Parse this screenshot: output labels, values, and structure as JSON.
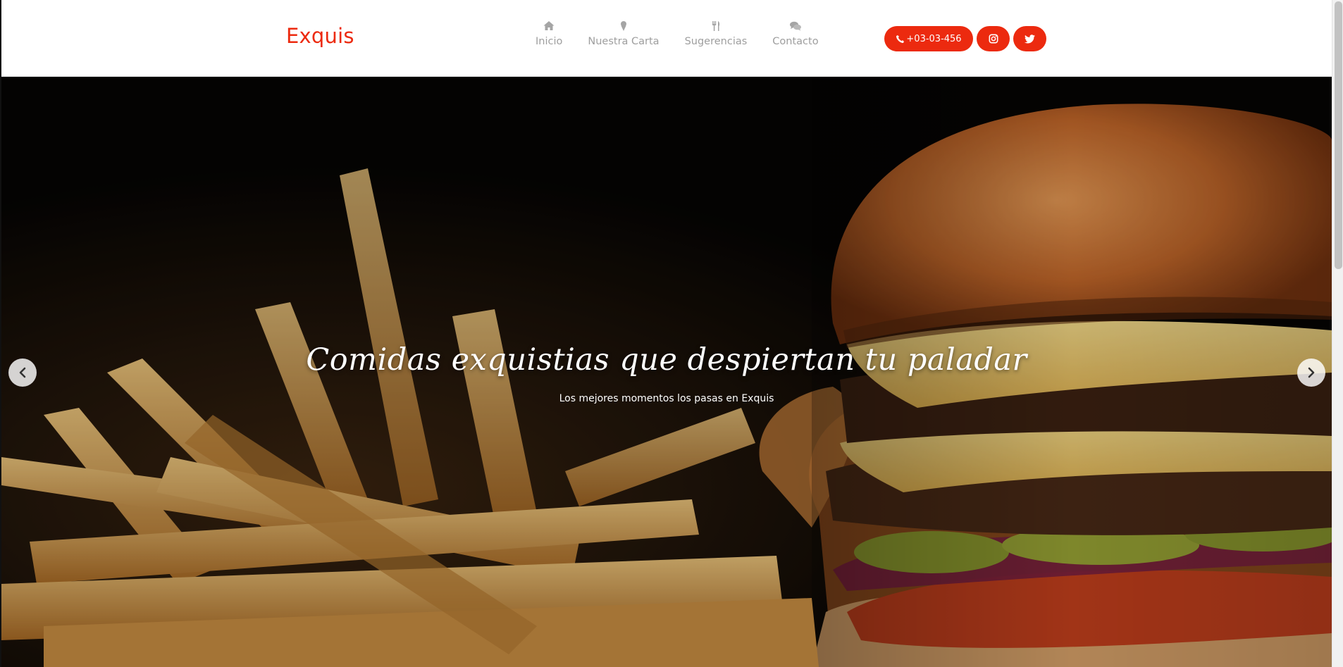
{
  "header": {
    "brand": "Exquis",
    "nav": [
      {
        "label": "Inicio",
        "icon": "home-icon"
      },
      {
        "label": "Nuestra Carta",
        "icon": "ice-cream-icon"
      },
      {
        "label": "Sugerencias",
        "icon": "cutlery-icon"
      },
      {
        "label": "Contacto",
        "icon": "comments-icon"
      }
    ],
    "phone_label": "+03-03-456",
    "social": [
      {
        "icon": "instagram-icon"
      },
      {
        "icon": "twitter-icon"
      }
    ]
  },
  "hero": {
    "title": "Comidas exquistias que despiertan tu paladar",
    "subtitle": "Los mejores momentos los pasas en Exquis"
  },
  "colors": {
    "accent": "#ec2a0f",
    "nav_text": "#9e9e9e",
    "hero_bg": "#050403"
  }
}
